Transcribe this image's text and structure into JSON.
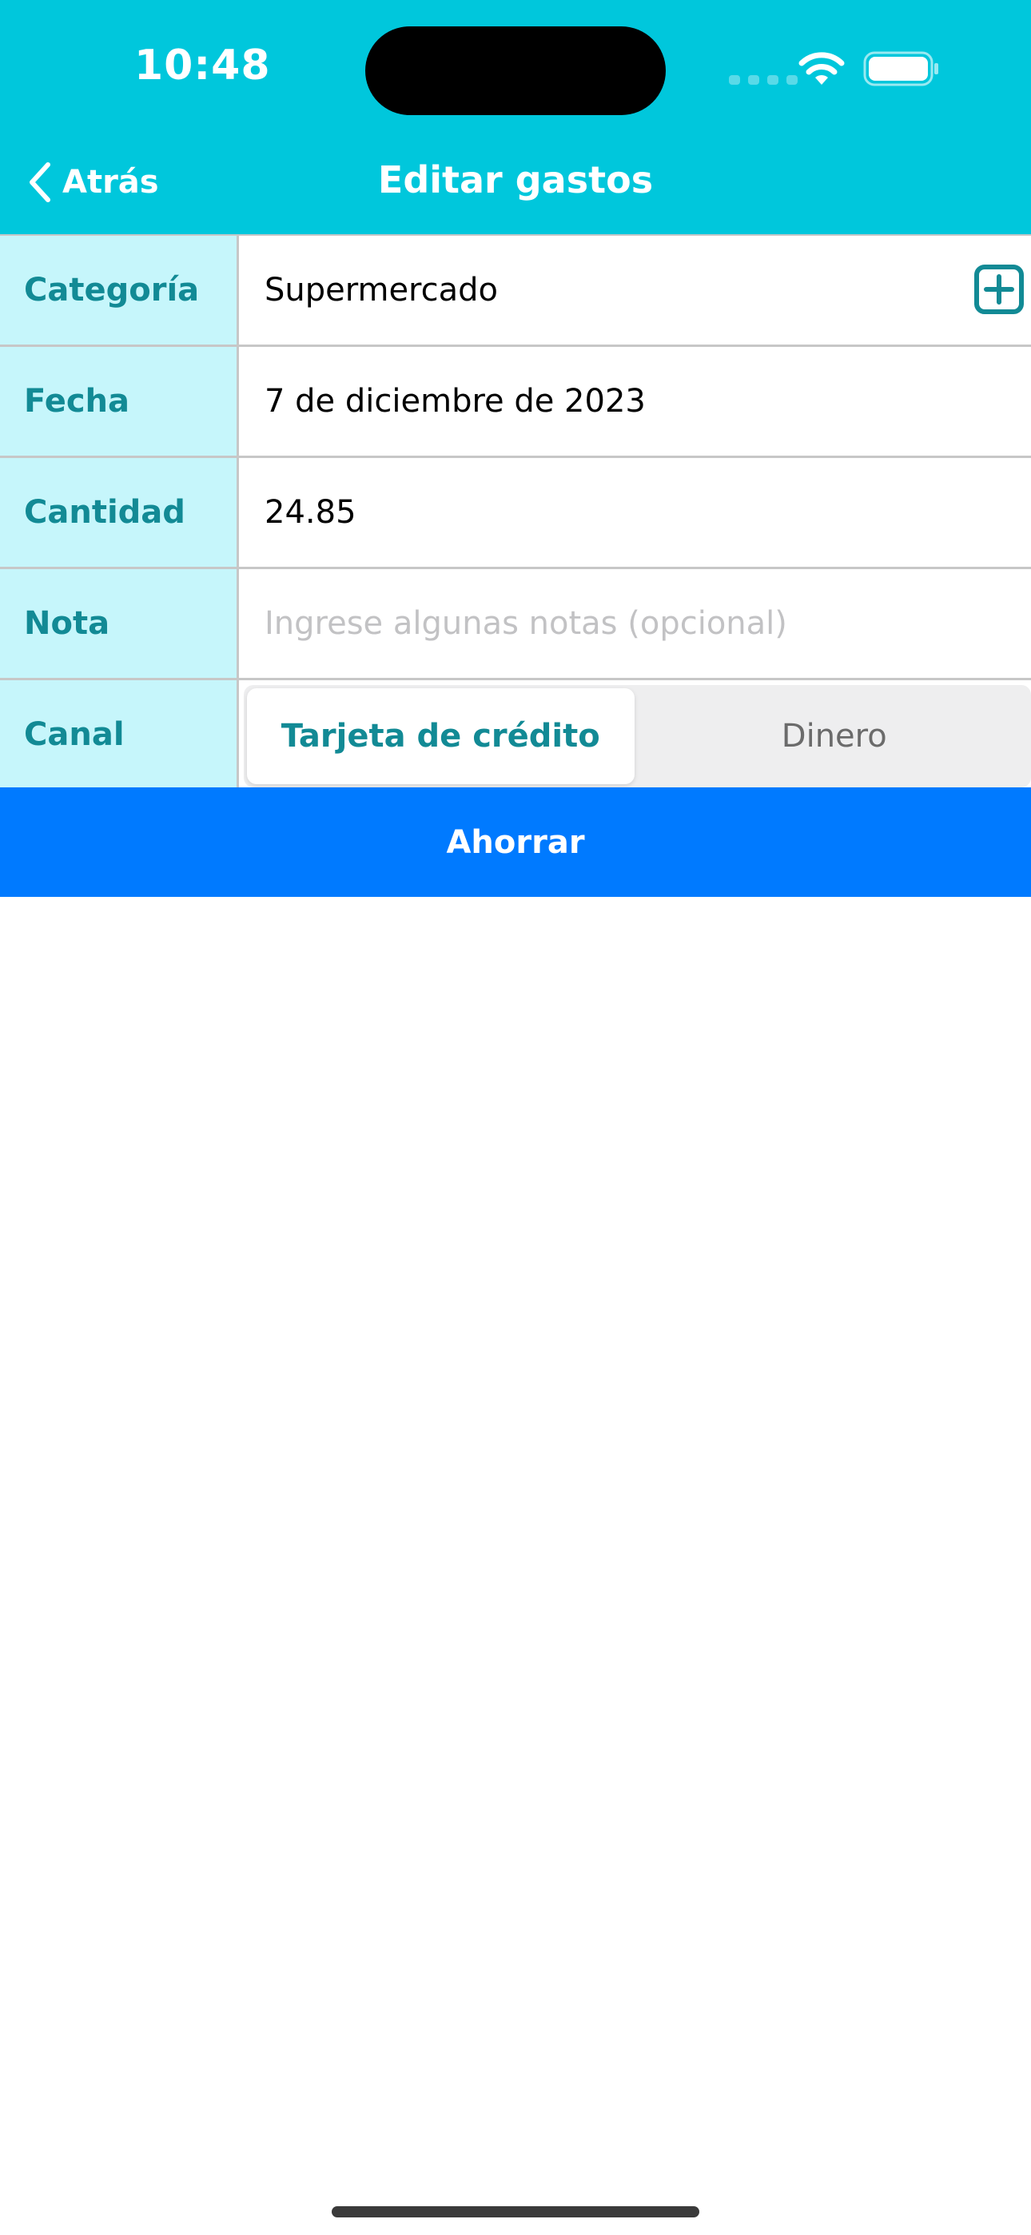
{
  "status_bar": {
    "time": "10:48"
  },
  "nav": {
    "back_label": "Atrás",
    "title": "Editar gastos"
  },
  "form": {
    "category": {
      "label": "Categoría",
      "value": "Supermercado"
    },
    "date": {
      "label": "Fecha",
      "value": "7 de diciembre de 2023"
    },
    "amount": {
      "label": "Cantidad",
      "value": "24.85"
    },
    "note": {
      "label": "Nota",
      "value": "",
      "placeholder": "Ingrese algunas notas (opcional)"
    },
    "channel": {
      "label": "Canal",
      "options": [
        "Tarjeta de crédito",
        "Dinero"
      ],
      "selected": "Tarjeta de crédito"
    }
  },
  "save_button": {
    "label": "Ahorrar"
  },
  "colors": {
    "header": "#00C7DC",
    "label_bg": "#C6F6FB",
    "label_text": "#128A95",
    "save_button": "#007AFF"
  }
}
